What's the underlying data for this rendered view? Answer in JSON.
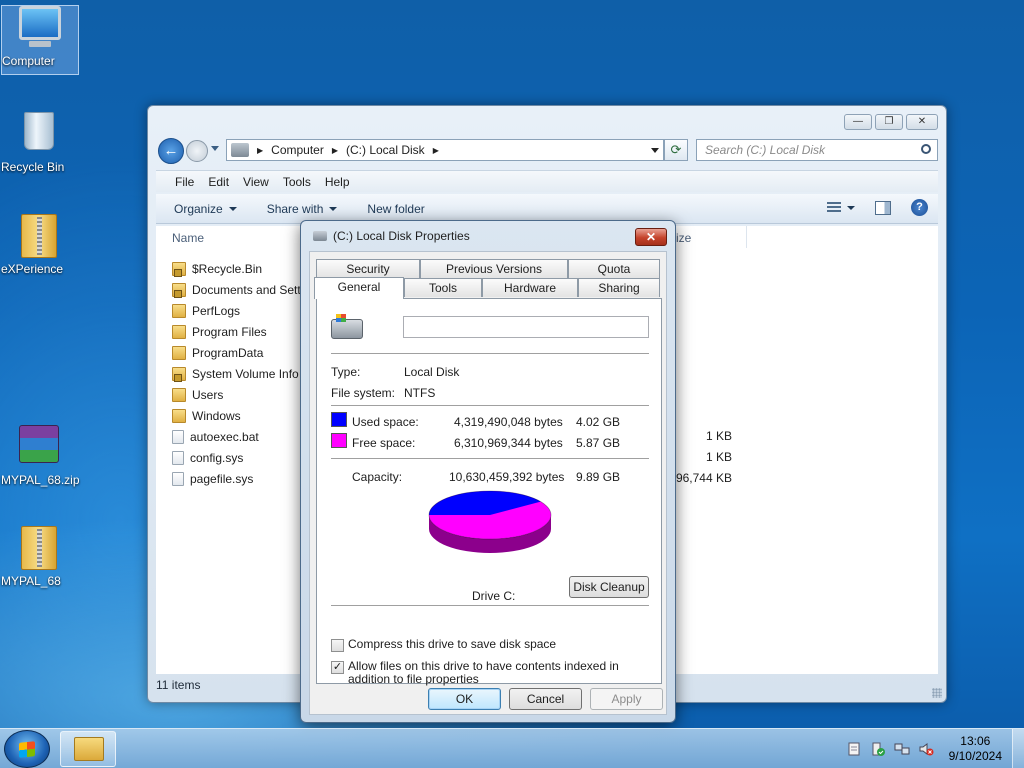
{
  "desktop": {
    "icons": [
      {
        "label": "Computer",
        "icon": "computer-icon"
      },
      {
        "label": "Recycle Bin",
        "icon": "recycle-bin-icon"
      },
      {
        "label": "eXPerience",
        "icon": "zip-folder-icon"
      },
      {
        "label": "MYPAL_68.zip",
        "icon": "winrar-archive-icon"
      },
      {
        "label": "MYPAL_68",
        "icon": "zip-folder-icon"
      }
    ]
  },
  "explorer": {
    "address": {
      "root": "Computer",
      "current": "(C:) Local Disk"
    },
    "search_placeholder": "Search (C:) Local Disk",
    "menu": [
      "File",
      "Edit",
      "View",
      "Tools",
      "Help"
    ],
    "commands": {
      "organize": "Organize",
      "share_with": "Share with",
      "new_folder": "New folder"
    },
    "columns": {
      "name": "Name",
      "size": "ize"
    },
    "files": [
      {
        "name": "$Recycle.Bin",
        "type": "lockfolder",
        "size": ""
      },
      {
        "name": "Documents and Sett",
        "type": "lockfolder",
        "size": ""
      },
      {
        "name": "PerfLogs",
        "type": "folder",
        "size": ""
      },
      {
        "name": "Program Files",
        "type": "folder",
        "size": ""
      },
      {
        "name": "ProgramData",
        "type": "folder",
        "size": ""
      },
      {
        "name": "System Volume Info",
        "type": "lockfolder",
        "size": ""
      },
      {
        "name": "Users",
        "type": "folder",
        "size": ""
      },
      {
        "name": "Windows",
        "type": "folder",
        "size": ""
      },
      {
        "name": "autoexec.bat",
        "type": "file",
        "size": "1 KB"
      },
      {
        "name": "config.sys",
        "type": "file",
        "size": "1 KB"
      },
      {
        "name": "pagefile.sys",
        "type": "file",
        "size": "2,096,744 KB"
      }
    ],
    "status": "11 items"
  },
  "dialog": {
    "title": "(C:) Local Disk Properties",
    "tabs_back": [
      "Security",
      "Previous Versions",
      "Quota"
    ],
    "tabs_front": [
      "General",
      "Tools",
      "Hardware",
      "Sharing"
    ],
    "active_tab": "General",
    "volume_label": "",
    "type_label": "Type:",
    "type_value": "Local Disk",
    "fs_label": "File system:",
    "fs_value": "NTFS",
    "used_label": "Used space:",
    "used_bytes": "4,319,490,048 bytes",
    "used_gb": "4.02 GB",
    "free_label": "Free space:",
    "free_bytes": "6,310,969,344 bytes",
    "free_gb": "5.87 GB",
    "capacity_label": "Capacity:",
    "capacity_bytes": "10,630,459,392 bytes",
    "capacity_gb": "9.89 GB",
    "used_color": "#0000ff",
    "free_color": "#ff00ff",
    "used_fraction": 0.406,
    "drive_label": "Drive C:",
    "cleanup_button": "Disk Cleanup",
    "compress_label": "Compress this drive to save disk space",
    "compress_checked": false,
    "index_label": "Allow files on this drive to have contents indexed in addition to file properties",
    "index_checked": true,
    "ok": "OK",
    "cancel": "Cancel",
    "apply": "Apply"
  },
  "taskbar": {
    "time": "13:06",
    "date": "9/10/2024"
  }
}
